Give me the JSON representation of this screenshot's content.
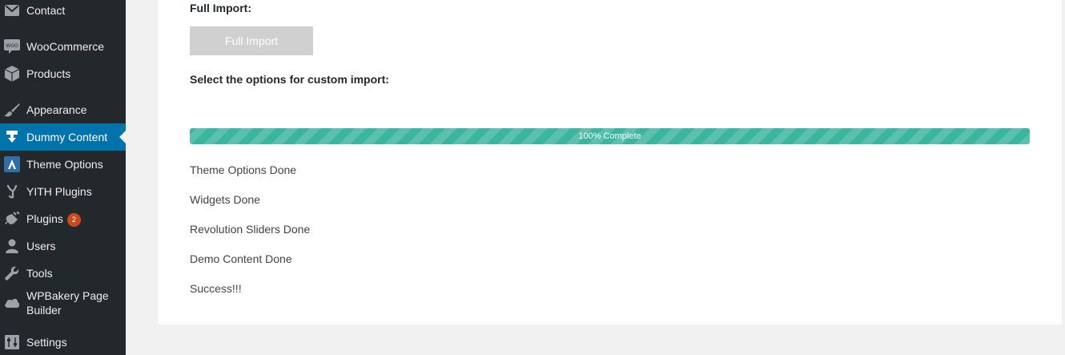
{
  "sidebar": {
    "items": [
      {
        "label": "Contact",
        "icon": "envelope-icon"
      },
      {
        "label": "WooCommerce",
        "icon": "woocommerce-icon"
      },
      {
        "label": "Products",
        "icon": "box-icon"
      },
      {
        "label": "Appearance",
        "icon": "paintbrush-icon"
      },
      {
        "label": "Dummy Content",
        "icon": "download-icon",
        "active": true
      },
      {
        "label": "Theme Options",
        "icon": "theme-logo-icon"
      },
      {
        "label": "YITH Plugins",
        "icon": "yith-icon"
      },
      {
        "label": "Plugins",
        "icon": "plug-icon",
        "badge": "2"
      },
      {
        "label": "Users",
        "icon": "user-icon"
      },
      {
        "label": "Tools",
        "icon": "wrench-icon"
      },
      {
        "label": "WPBakery Page Builder",
        "icon": "wpbakery-cloud-icon"
      },
      {
        "label": "Settings",
        "icon": "sliders-icon"
      }
    ]
  },
  "main": {
    "full_import_heading": "Full Import:",
    "full_import_button": "Full Import",
    "custom_import_heading": "Select the options for custom import:",
    "progress": {
      "percent": 100,
      "label": "100% Complete"
    },
    "log": [
      "Theme Options Done",
      "Widgets Done",
      "Revolution Sliders Done",
      "Demo Content Done",
      "Success!!!"
    ]
  },
  "colors": {
    "sidebar_bg": "#23282d",
    "active_item": "#0073aa",
    "progress_bar": "#3ab59e",
    "badge": "#ca4a1f",
    "button_disabled": "#d0d0d0"
  }
}
